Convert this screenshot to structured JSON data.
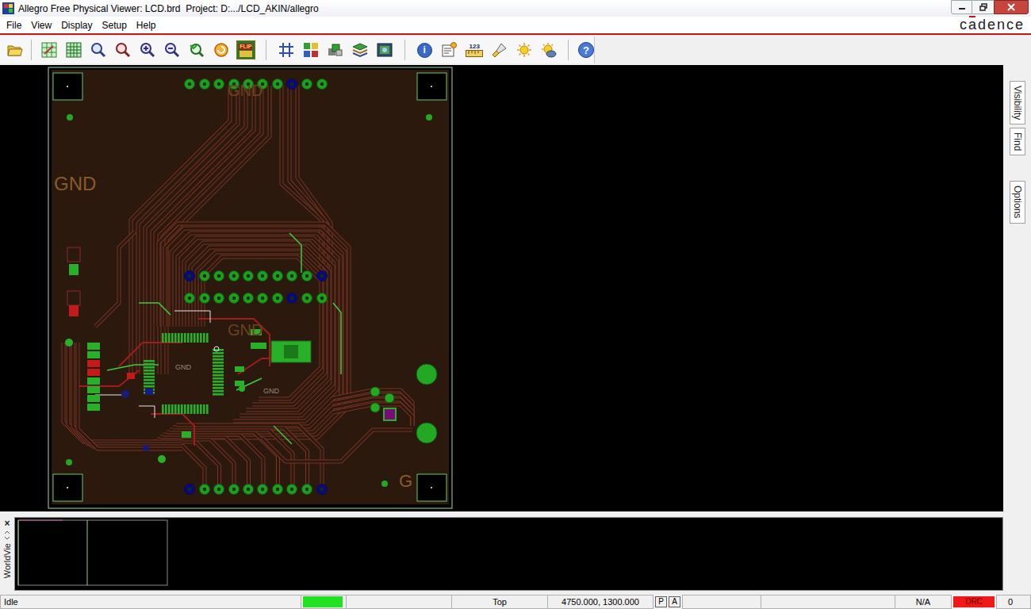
{
  "window": {
    "title": "Allegro Free Physical Viewer: LCD.brd  Project: D:.../LCD_AKIN/allegro"
  },
  "menu": [
    "File",
    "View",
    "Display",
    "Setup",
    "Help"
  ],
  "logo": "cadence",
  "toolbar": {
    "flip": "FLIP",
    "info": "i",
    "counter": "123",
    "help": "?"
  },
  "side_tabs": [
    "Visibility",
    "Find",
    "Options"
  ],
  "board": {
    "labels": [
      "GND",
      "GND",
      "GND",
      "GND",
      "GND",
      "G"
    ]
  },
  "worldview": {
    "close": "×",
    "label": "WorldVie"
  },
  "status_bar": {
    "state": "Idle",
    "ready": true,
    "layer": "Top",
    "coords": "4750.000, 1300.000",
    "p": "P",
    "a": "A",
    "na": "N/A",
    "drc": "DRC",
    "drc_error": true,
    "count": "0"
  }
}
